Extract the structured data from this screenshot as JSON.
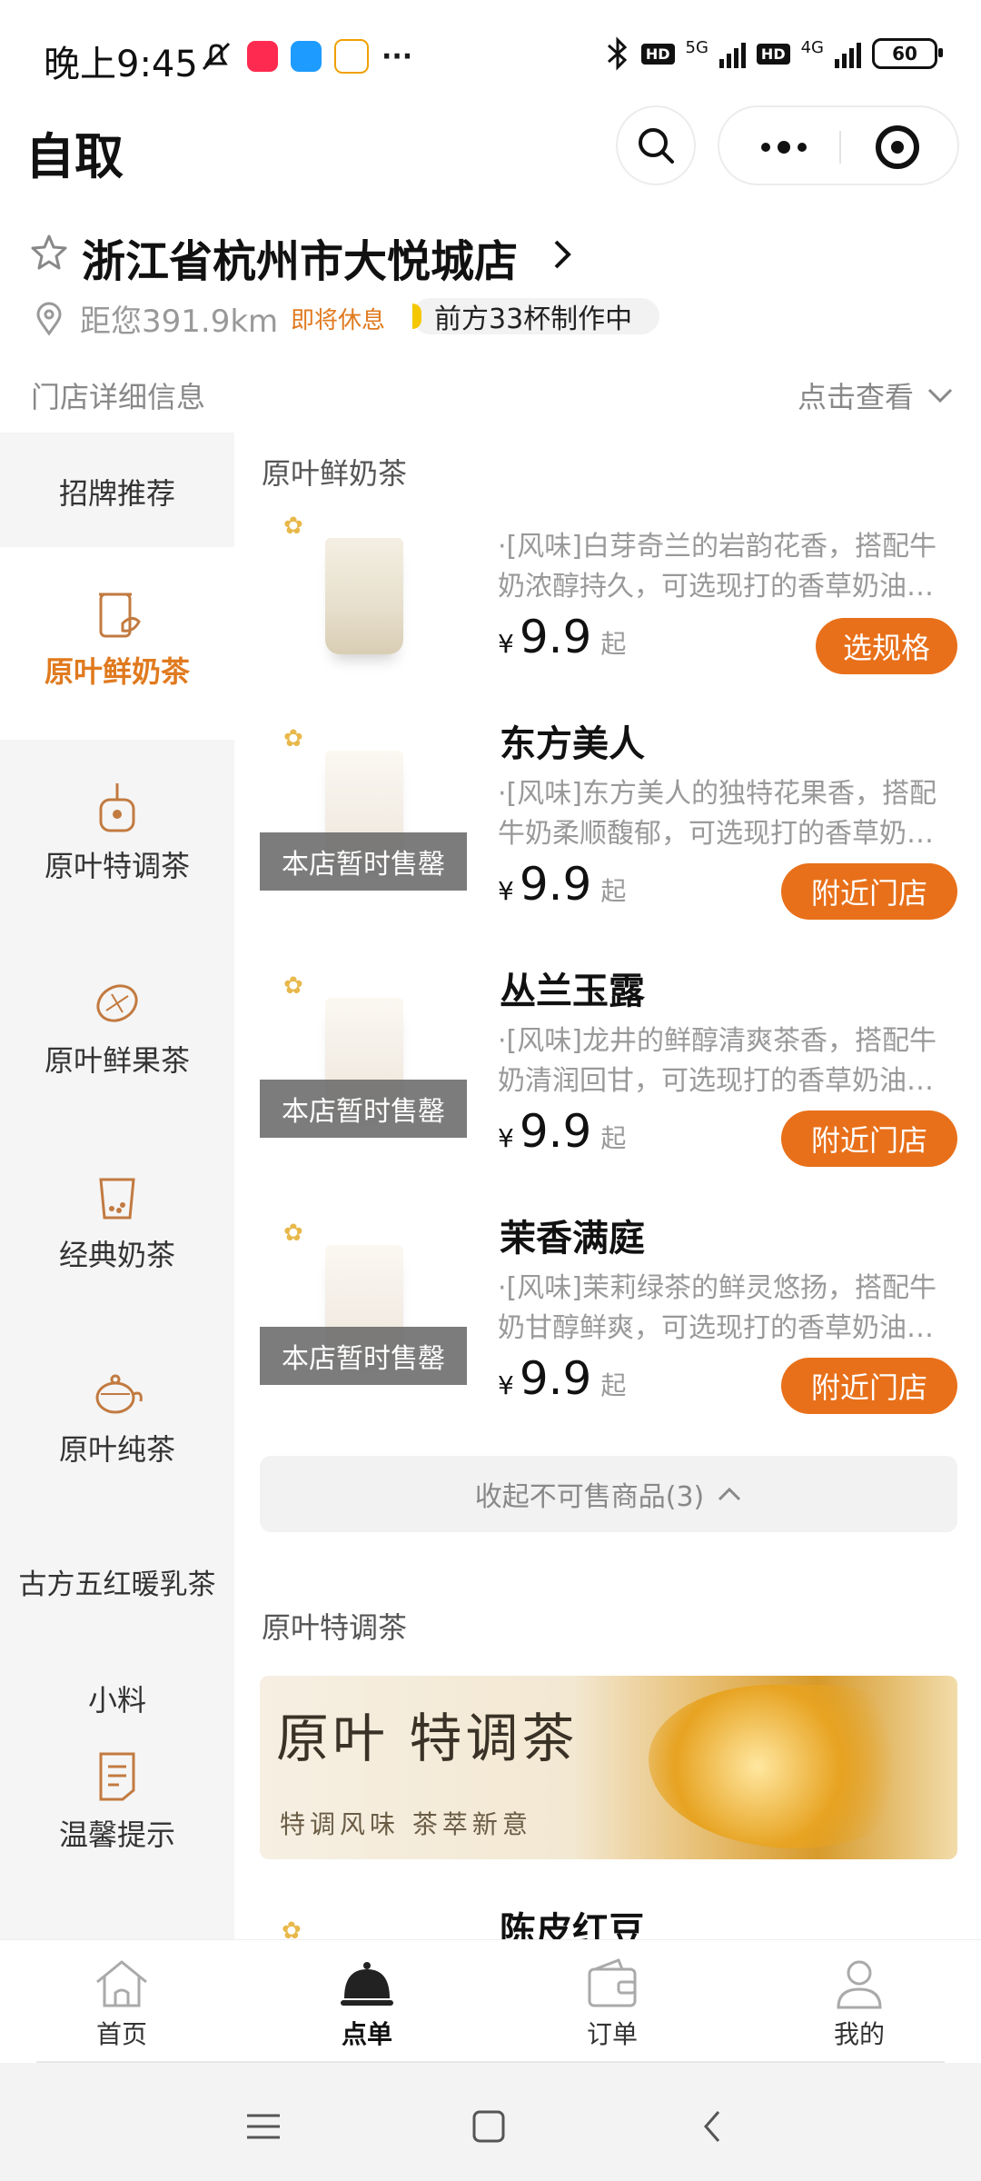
{
  "status_bar": {
    "time": "晚上9:45",
    "dots": "···",
    "net_5g": "5G",
    "net_4g": "4G",
    "hd": "HD",
    "battery": "60"
  },
  "header": {
    "title": "自取"
  },
  "store": {
    "name": "浙江省杭州市大悦城店",
    "distance": "距您391.9km",
    "status": "即将休息",
    "queue": "前方33杯制作中",
    "detail_label": "门店详细信息",
    "detail_action": "点击查看"
  },
  "sidebar": {
    "items": [
      {
        "label": "招牌推荐",
        "icon": "none"
      },
      {
        "label": "原叶鲜奶茶",
        "icon": "milk-tea-cup-icon",
        "active": true
      },
      {
        "label": "原叶特调茶",
        "icon": "special-tea-icon"
      },
      {
        "label": "原叶鲜果茶",
        "icon": "lemon-icon"
      },
      {
        "label": "经典奶茶",
        "icon": "pearl-cup-icon"
      },
      {
        "label": "原叶纯茶",
        "icon": "teapot-icon"
      },
      {
        "label": "古方五红暖乳茶",
        "icon": "none"
      },
      {
        "label": "小料",
        "icon": "none"
      },
      {
        "label": "温馨提示",
        "icon": "note-icon"
      }
    ]
  },
  "sections": {
    "first_title": "原叶鲜奶茶",
    "second_title": "原叶特调茶",
    "collapse_label": "收起不可售商品(3)"
  },
  "products": [
    {
      "name": "",
      "desc": "·[风味]白芽奇兰的岩韵花香，搭配牛奶浓醇持久，可选现打的香草奶油…",
      "currency": "¥",
      "price": "9.9",
      "suffix": "起",
      "button": "选规格",
      "soldout": ""
    },
    {
      "name": "东方美人",
      "desc": "·[风味]东方美人的独特花果香，搭配牛奶柔顺馥郁，可选现打的香草奶…",
      "currency": "¥",
      "price": "9.9",
      "suffix": "起",
      "button": "附近门店",
      "soldout": "本店暂时售罄"
    },
    {
      "name": "丛兰玉露",
      "desc": "·[风味]龙井的鲜醇清爽茶香，搭配牛奶清润回甘，可选现打的香草奶油…",
      "currency": "¥",
      "price": "9.9",
      "suffix": "起",
      "button": "附近门店",
      "soldout": "本店暂时售罄"
    },
    {
      "name": "茉香满庭",
      "desc": "·[风味]茉莉绿茶的鲜灵悠扬，搭配牛奶甘醇鲜爽，可选现打的香草奶油…",
      "currency": "¥",
      "price": "9.9",
      "suffix": "起",
      "button": "附近门店",
      "soldout": "本店暂时售罄"
    }
  ],
  "banner": {
    "title": "原叶 特调茶",
    "subtitle": "特调风味 茶萃新意"
  },
  "partial_product": {
    "name": "陈皮红豆"
  },
  "tabbar": {
    "tabs": [
      {
        "label": "首页",
        "icon": "home-icon"
      },
      {
        "label": "点单",
        "icon": "cloche-icon",
        "active": true
      },
      {
        "label": "订单",
        "icon": "wallet-icon"
      },
      {
        "label": "我的",
        "icon": "person-icon"
      }
    ]
  },
  "colors": {
    "accent": "#e8701a",
    "active_category": "#e07a1f",
    "sidebar_bg": "#f5f5f5"
  }
}
